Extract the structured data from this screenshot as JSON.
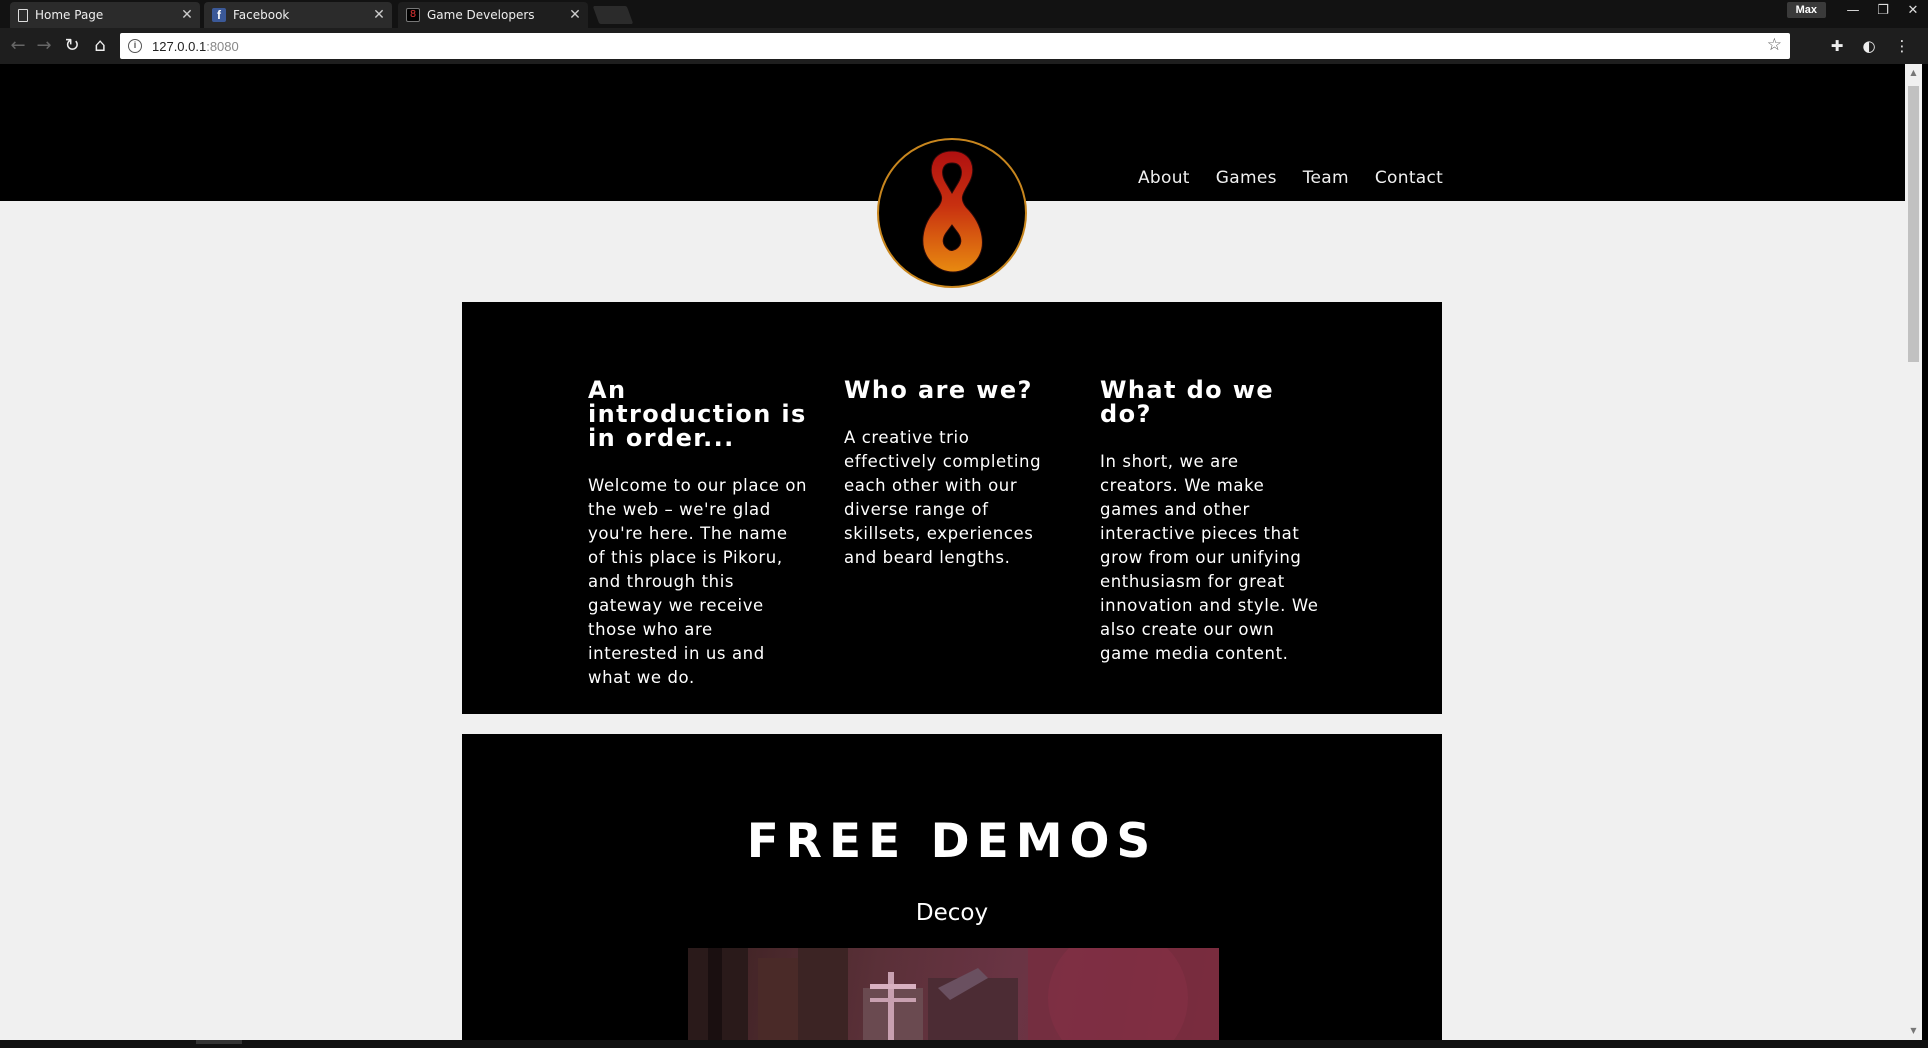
{
  "browser": {
    "tabs": [
      {
        "label": "Home Page",
        "icon": "page-icon",
        "active": false
      },
      {
        "label": "Facebook",
        "icon": "facebook-icon",
        "active": false
      },
      {
        "label": "Game Developers",
        "icon": "pikoru-icon",
        "active": true
      }
    ],
    "profile_name": "Max",
    "address": {
      "host": "127.0.0.1",
      "port": ":8080"
    }
  },
  "site": {
    "nav": [
      "About",
      "Games",
      "Team",
      "Contact"
    ],
    "logo_colors": {
      "top": "#b01010",
      "bottom": "#e88a10",
      "ring": "#c8861e"
    },
    "intro": {
      "columns": [
        {
          "title": "An introduction is in order...",
          "text": "Welcome to our place on the web – we're glad you're here. The name of this place is Pikoru, and through this gateway we receive those who are interested in us and what we do."
        },
        {
          "title": "Who are we?",
          "text": "A creative trio effectively completing each other with our diverse range of skillsets, experiences and beard lengths."
        },
        {
          "title": "What do we do?",
          "text": "In short, we are creators. We make games and other interactive pieces that grow from our unifying enthusiasm for great innovation and style. We also create our own game media content."
        }
      ]
    },
    "demos": {
      "title": "FREE DEMOS",
      "items": [
        {
          "name": "Decoy"
        }
      ]
    }
  }
}
